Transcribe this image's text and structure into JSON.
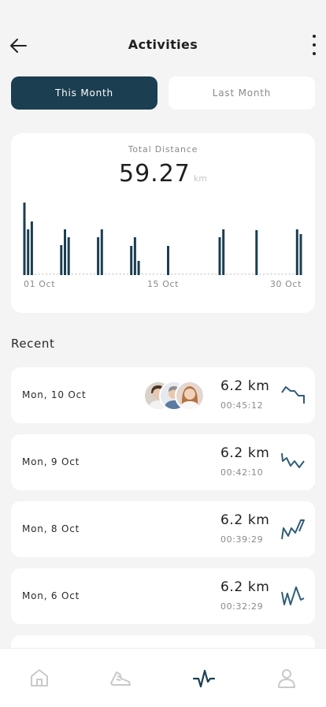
{
  "header": {
    "title": "Activities",
    "back_icon": "arrow-left-icon",
    "more_icon": "more-vertical-icon"
  },
  "tabs": [
    {
      "label": "This Month",
      "active": true
    },
    {
      "label": "Last Month",
      "active": false
    }
  ],
  "summary": {
    "label": "Total Distance",
    "value": "59.27",
    "unit": "km"
  },
  "chart_data": {
    "type": "bar",
    "title": "",
    "x_tick_labels": [
      "01 Oct",
      "15 Oct",
      "30 Oct"
    ],
    "ylim": [
      0,
      1
    ],
    "grid": false,
    "colors": {
      "bar": "#1b3e51",
      "empty_marker": "#e3e3e3"
    },
    "values": [
      0.98,
      0.58,
      0.68,
      0,
      0,
      0,
      0,
      0,
      0,
      0,
      0.38,
      0.58,
      0.48,
      0,
      0,
      0,
      0,
      0,
      0,
      0,
      0.48,
      0.58,
      0,
      0,
      0,
      0,
      0,
      0,
      0,
      0.37,
      0.48,
      0.18,
      0,
      0,
      0,
      0,
      0,
      0,
      0,
      0.37,
      0,
      0,
      0,
      0,
      0,
      0,
      0,
      0,
      0,
      0,
      0,
      0,
      0,
      0.48,
      0.58,
      0,
      0,
      0,
      0,
      0,
      0,
      0,
      0,
      0.57,
      0,
      0,
      0,
      0,
      0,
      0,
      0,
      0,
      0,
      0,
      0.58,
      0.52
    ]
  },
  "recent": {
    "title": "Recent",
    "items": [
      {
        "date": "Mon, 10 Oct",
        "distance": "6.2 km",
        "duration": "00:45:12",
        "has_avatars": true,
        "trend_icon": "trend-line-icon"
      },
      {
        "date": "Mon, 9 Oct",
        "distance": "6.2 km",
        "duration": "00:42:10",
        "has_avatars": false,
        "trend_icon": "trend-line-icon"
      },
      {
        "date": "Mon, 8 Oct",
        "distance": "6.2 km",
        "duration": "00:39:29",
        "has_avatars": false,
        "trend_icon": "trend-line-icon"
      },
      {
        "date": "Mon, 6 Oct",
        "distance": "6.2 km",
        "duration": "00:32:29",
        "has_avatars": false,
        "trend_icon": "trend-line-icon"
      }
    ]
  },
  "bottom_nav": [
    {
      "icon": "home-icon",
      "active": false
    },
    {
      "icon": "running-shoe-icon",
      "active": false
    },
    {
      "icon": "activity-pulse-icon",
      "active": true
    },
    {
      "icon": "profile-icon",
      "active": false
    }
  ],
  "colors": {
    "accent": "#1b3e51",
    "background": "#f4f4f4",
    "card": "#ffffff",
    "muted_text": "#8a8a8a"
  }
}
